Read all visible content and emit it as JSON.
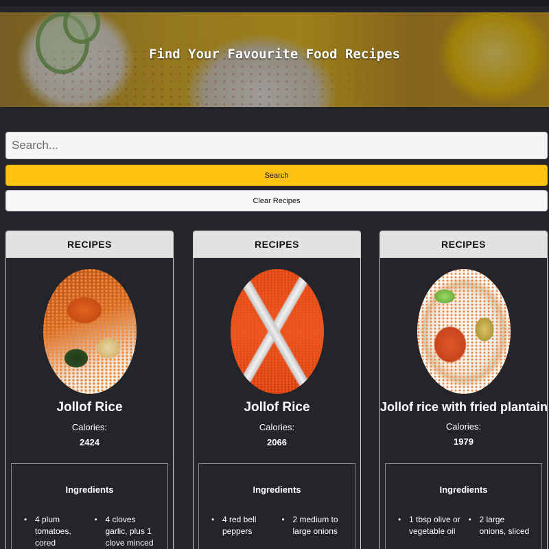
{
  "hero": {
    "title": "Find Your Favourite Food Recipes"
  },
  "search": {
    "placeholder": "Search...",
    "value": "",
    "search_label": "Search",
    "clear_label": "Clear Recipes"
  },
  "recipes": [
    {
      "header": "RECIPES",
      "image_icon": "jollof-rice-photo",
      "title": "Jollof Rice",
      "calories_label": "Calories:",
      "calories": "2424",
      "ingredients_label": "Ingredients",
      "ingredients": [
        "4 plum tomatoes, cored",
        "4 cloves garlic, plus 1 clove minced"
      ]
    },
    {
      "header": "RECIPES",
      "image_icon": "jollof-rice-tray-photo",
      "title": "Jollof Rice",
      "calories_label": "Calories:",
      "calories": "2066",
      "ingredients_label": "Ingredients",
      "ingredients": [
        "4 red bell peppers",
        "2 medium to large onions"
      ]
    },
    {
      "header": "RECIPES",
      "image_icon": "jollof-plantains-photo",
      "title": "Jollof rice with fried plantains",
      "calories_label": "Calories:",
      "calories": "1979",
      "ingredients_label": "Ingredients",
      "ingredients": [
        "1 tbsp olive or vegetable oil",
        "2 large onions, sliced"
      ]
    }
  ],
  "colors": {
    "background": "#24252b",
    "search_button": "#ffc20e",
    "card_header": "#e4e2e1"
  }
}
